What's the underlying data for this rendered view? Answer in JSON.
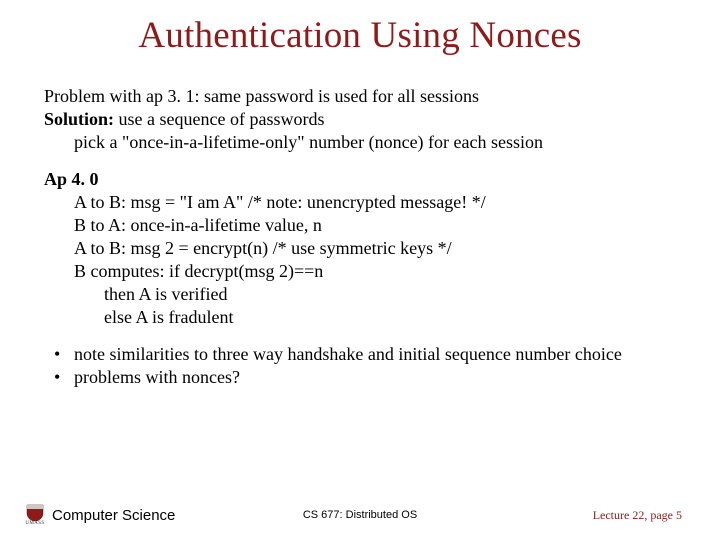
{
  "title": "Authentication Using Nonces",
  "para1": {
    "line1a": "Problem with ap 3. 1: same password is used for all sessions",
    "line2_bold": "Solution:",
    "line2_rest": " use a sequence of passwords",
    "line3": "pick a \"once-in-a-lifetime-only\" number (nonce)  for each session"
  },
  "para2": {
    "head": "Ap 4. 0",
    "l1": "A to B: msg = \"I am A\"  /* note: unencrypted message! */",
    "l2": "B to A: once-in-a-lifetime value, n",
    "l3": "A to B: msg 2 = encrypt(n) /* use symmetric keys */",
    "l4": "B computes: if decrypt(msg 2)==n",
    "l5": "then A is verified",
    "l6": "else A is fradulent"
  },
  "bullets": {
    "b1": "note similarities to three way handshake and initial sequence number choice",
    "b2": "problems with nonces?"
  },
  "footer": {
    "left": "Computer Science",
    "logo_sub": "UMASS",
    "center": "CS 677: Distributed OS",
    "right": "Lecture 22, page 5"
  }
}
